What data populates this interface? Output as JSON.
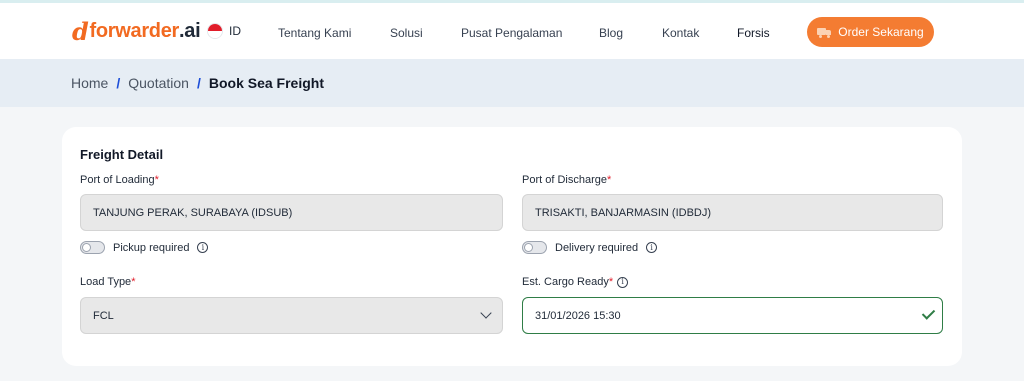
{
  "brand": {
    "logo_mark": "d",
    "logo_text": "forwarder",
    "logo_tld": ".ai",
    "accent_color": "#f26a21"
  },
  "nav": {
    "language": "ID",
    "language_flag_icon": "indonesia-flag-icon",
    "items": [
      "Tentang Kami",
      "Solusi",
      "Pusat Pengalaman",
      "Blog",
      "Kontak",
      "Forsis"
    ],
    "order_button": "Order Sekarang",
    "order_button_icon": "truck-icon"
  },
  "breadcrumb": {
    "items": [
      "Home",
      "Quotation"
    ],
    "separator": "/",
    "current": "Book Sea Freight"
  },
  "form": {
    "section_title": "Freight Detail",
    "required_marker": "*",
    "port_of_loading": {
      "label": "Port of Loading",
      "value": "TANJUNG PERAK, SURABAYA (IDSUB)"
    },
    "port_of_discharge": {
      "label": "Port of Discharge",
      "value": "TRISAKTI, BANJARMASIN (IDBDJ)"
    },
    "pickup": {
      "label": "Pickup required",
      "checked": false
    },
    "delivery": {
      "label": "Delivery required",
      "checked": false
    },
    "load_type": {
      "label": "Load Type",
      "value": "FCL"
    },
    "cargo_ready": {
      "label": "Est. Cargo Ready",
      "value": "31/01/2026 15:30",
      "valid_color": "#2f7d46"
    },
    "info_glyph": "i"
  }
}
